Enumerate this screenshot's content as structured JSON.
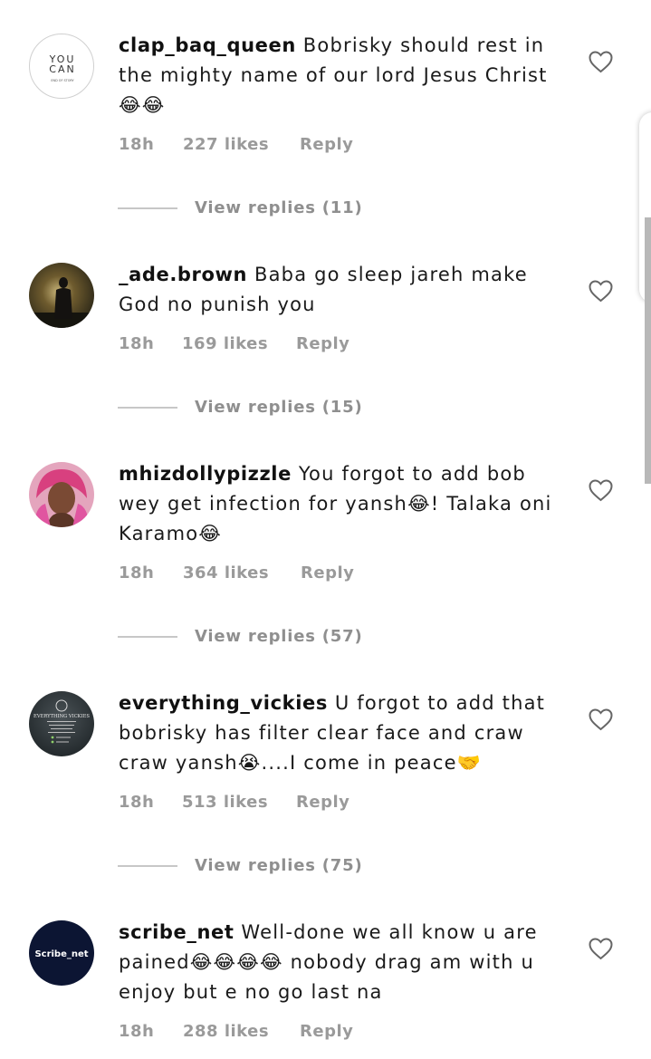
{
  "comments": [
    {
      "username": "clap_baq_queen",
      "text": "Bobrisky should rest in the mighty name of our lord Jesus Christ 😂😂",
      "time": "18h",
      "likes": "227 likes",
      "reply": "Reply",
      "view_replies": "View replies (11)",
      "avatar": {
        "type": "text",
        "line1": "YOU",
        "line2": "CAN",
        "line3": "END OF STORY"
      }
    },
    {
      "username": "_ade.brown",
      "text": "Baba go sleep jareh make God no punish you",
      "time": "18h",
      "likes": "169 likes",
      "reply": "Reply",
      "view_replies": "View replies (15)",
      "avatar": {
        "type": "photo-silhouette"
      }
    },
    {
      "username": "mhizdollypizzle",
      "text": "You forgot to add bob wey get infection for yansh😂! Talaka oni Karamo😂",
      "time": "18h",
      "likes": "364 likes",
      "reply": "Reply",
      "view_replies": "View replies (57)",
      "avatar": {
        "type": "photo-portrait"
      }
    },
    {
      "username": "everything_vickies",
      "text": "U forgot to add that bobrisky has filter clear face and craw craw yansh😭....I come in peace🤝",
      "time": "18h",
      "likes": "513 likes",
      "reply": "Reply",
      "view_replies": "View replies (75)",
      "avatar": {
        "type": "logo",
        "label": "EVERYTHING VICKIES"
      }
    },
    {
      "username": "scribe_net",
      "text": "Well-done we all know u are pained😂😂😂😂 nobody drag am with u enjoy but e no go last na",
      "time": "18h",
      "likes": "288 likes",
      "reply": "Reply",
      "avatar": {
        "type": "logo",
        "label": "Scribe_net"
      }
    }
  ],
  "icons": {
    "like": "heart-outline-icon"
  },
  "colors": {
    "text": "#1a1a1a",
    "meta": "#9a9a9a",
    "divider": "#c7c7c7"
  }
}
